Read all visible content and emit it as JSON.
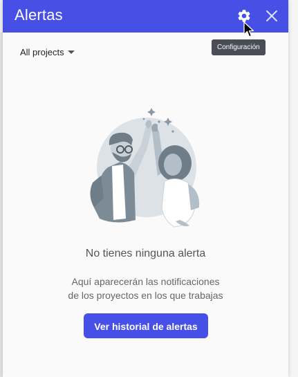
{
  "header": {
    "title": "Alertas",
    "color": "#4650e6"
  },
  "tooltip": {
    "text": "Configuración"
  },
  "project_filter": {
    "selected": "All projects"
  },
  "empty_state": {
    "title": "No tienes ninguna alerta",
    "description_line1": "Aquí aparecerán las notificaciones",
    "description_line2": "de los proyectos en los que trabajas",
    "button_label": "Ver historial de alertas"
  },
  "icons": {
    "settings": "gear-icon",
    "close": "close-icon",
    "dropdown": "caret-down-icon",
    "cursor": "mouse-pointer-icon"
  }
}
